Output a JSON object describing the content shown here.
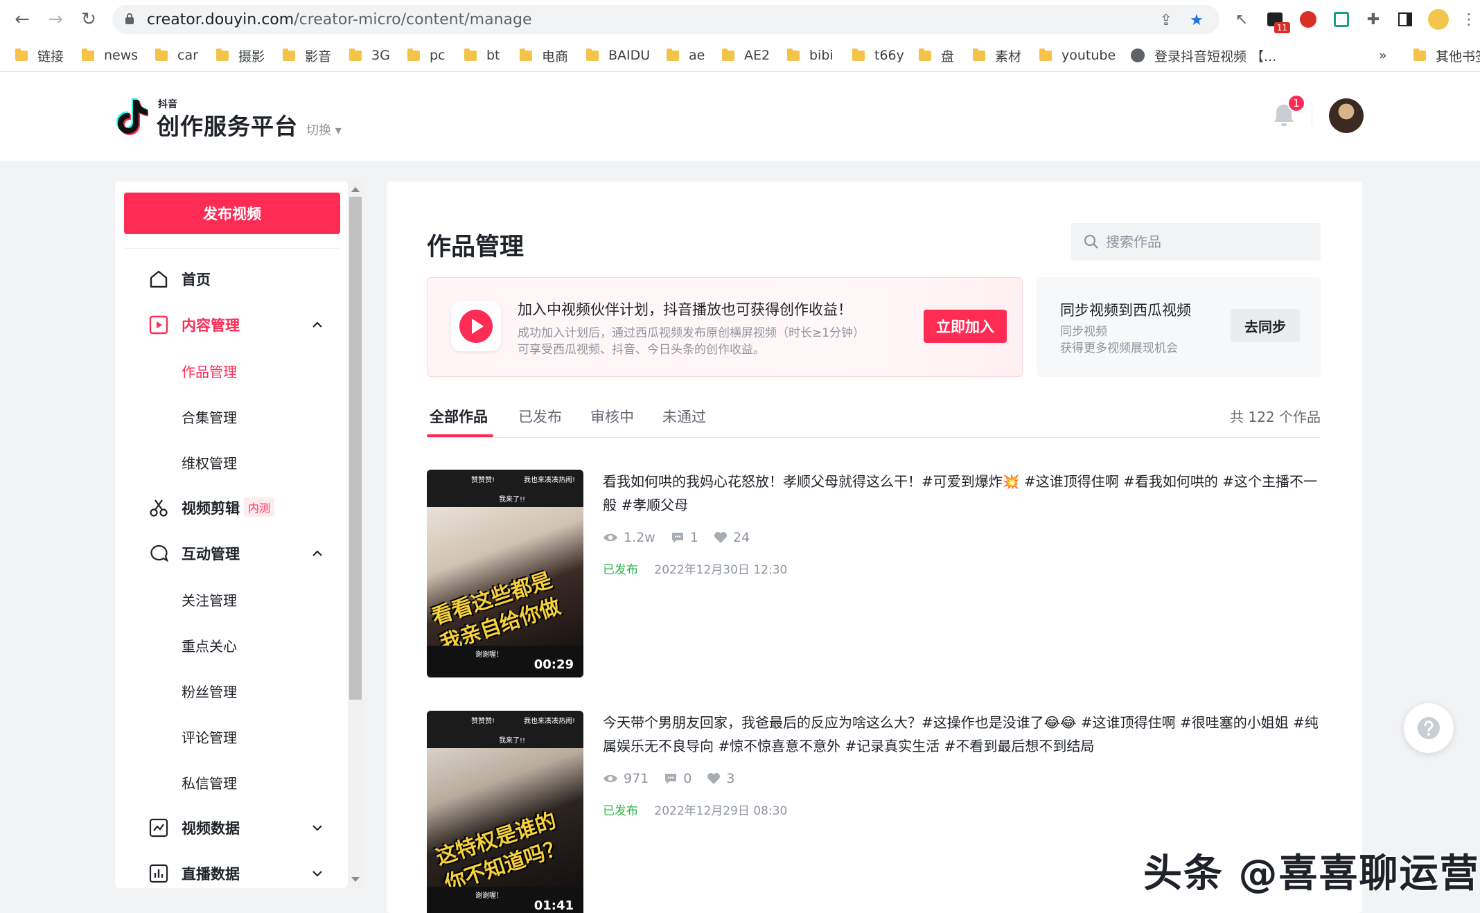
{
  "browser": {
    "url_host": "creator.douyin.com",
    "url_path": "/creator-micro/content/manage",
    "extension_badge": "11",
    "bookmarks": [
      "链接",
      "news",
      "car",
      "摄影",
      "影音",
      "3G",
      "pc",
      "bt",
      "电商",
      "BAIDU",
      "ae",
      "AE2",
      "bibi",
      "t66y",
      "盘",
      "素材",
      "youtube"
    ],
    "bookmark_special": "登录抖音短视频 【...",
    "bookmark_more": "»",
    "bookmark_other": "其他书签"
  },
  "header": {
    "logo_small": "抖音",
    "logo_title": "创作服务平台",
    "switch_label": "切换",
    "notification_count": "1"
  },
  "sidebar": {
    "publish_label": "发布视频",
    "items": [
      {
        "label": "首页"
      },
      {
        "label": "内容管理"
      },
      {
        "label": "作品管理"
      },
      {
        "label": "合集管理"
      },
      {
        "label": "维权管理"
      },
      {
        "label": "视频剪辑",
        "tag": "内测"
      },
      {
        "label": "互动管理"
      },
      {
        "label": "关注管理"
      },
      {
        "label": "重点关心"
      },
      {
        "label": "粉丝管理"
      },
      {
        "label": "评论管理"
      },
      {
        "label": "私信管理"
      },
      {
        "label": "视频数据"
      },
      {
        "label": "直播数据"
      }
    ]
  },
  "main": {
    "title": "作品管理",
    "search_placeholder": "搜索作品",
    "banner_partner": {
      "title": "加入中视频伙伴计划，抖音播放也可获得创作收益！",
      "desc_line1": "成功加入计划后，通过西瓜视频发布原创横屏视频（时长≥1分钟）",
      "desc_line2": "可享受西瓜视频、抖音、今日头条的创作收益。",
      "button": "立即加入"
    },
    "banner_sync": {
      "title": "同步视频到西瓜视频",
      "line1": "同步视频",
      "line2": "获得更多视频展现机会",
      "button": "去同步"
    },
    "tabs": [
      "全部作品",
      "已发布",
      "审核中",
      "未通过"
    ],
    "total": "共 122 个作品",
    "works": [
      {
        "title": "看我如何哄的我妈心花怒放！孝顺父母就得这么干！#可爱到爆炸💥 #这谁顶得住啊 #看我如何哄的 #这个主播不一般 #孝顺父母",
        "views": "1.2w",
        "comments": "1",
        "likes": "24",
        "status": "已发布",
        "time": "2022年12月30日 12:30",
        "duration": "00:29",
        "cover_caption": "看看这些都是我亲自给你做的喔"
      },
      {
        "title": "今天带个男朋友回家，我爸最后的反应为啥这么大？#这操作也是没谁了😂😂 #这谁顶得住啊 #很哇塞的小姐姐 #纯属娱乐无不良导向 #惊不惊喜意不意外 #记录真实生活 #不看到最后想不到结局",
        "views": "971",
        "comments": "0",
        "likes": "3",
        "status": "已发布",
        "time": "2022年12月29日 08:30",
        "duration": "01:41",
        "cover_caption": "这特权是谁的你不知道吗？"
      }
    ],
    "cover_top_labels": [
      "赞赞赞!",
      "我也来凑凑热闹!",
      "我来了!!"
    ],
    "cover_bottom_label": "谢谢喔！"
  },
  "watermark": "头条 @喜喜聊运营",
  "colors": {
    "brand": "#fe2c55",
    "success": "#2bb44a",
    "muted": "#8f959e"
  }
}
